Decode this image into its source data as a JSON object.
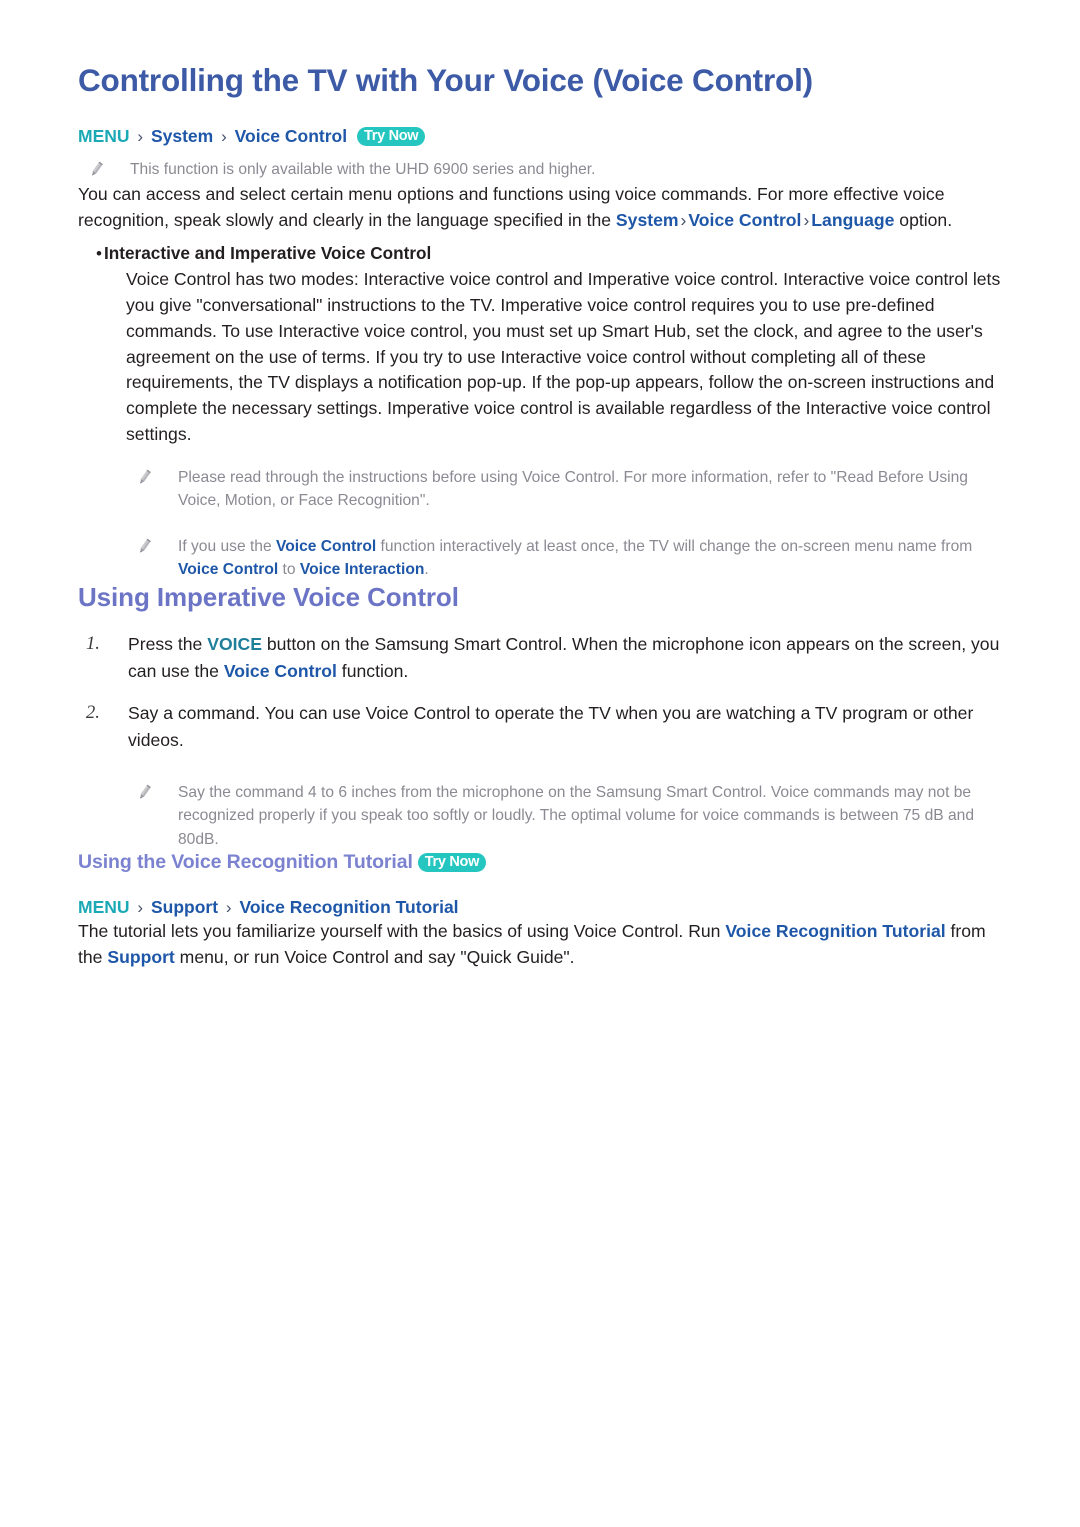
{
  "doc": {
    "title": "Controlling the TV with Your Voice (Voice Control)",
    "try_now_label": "Try Now",
    "arrow": "›",
    "bullet": "•"
  },
  "colors": {
    "title_blue": "#3c5aa6",
    "section_purple": "#6c74c6",
    "link_blue": "#1f57a8",
    "menu_teal": "#1aa9b5",
    "badge_teal": "#26c6c0",
    "note_gray": "#8a8a92",
    "body_black": "#231f20",
    "voice_teal": "#1f7f9b"
  },
  "breadcrumb_top": {
    "menu": "MENU",
    "items": [
      "System",
      "Voice Control"
    ]
  },
  "notes": {
    "availability": "This function is only available with the UHD 6900 series and higher.",
    "read_instructions": {
      "part1": "Please read through the instructions before using Voice Control. For more information, refer to \"Read Before Using Voice, Motion, or Face Recognition\"."
    },
    "interactive_rename": {
      "p1": "If you use the ",
      "link1": "Voice Control",
      "p2": " function interactively at least once, the TV will change the on-screen menu name from ",
      "link2": "Voice Control",
      "p3": " to ",
      "link3": "Voice Interaction",
      "p4": "."
    },
    "distance": "Say the command 4 to 6 inches from the microphone on the Samsung Smart Control. Voice commands may not be recognized properly if you speak too softly or loudly. The optimal volume for voice commands is between 75 dB and 80dB."
  },
  "intro": {
    "p1": "You can access and select certain menu options and functions using voice commands. For more effective voice recognition, speak slowly and clearly in the language specified in the ",
    "link_system": "System",
    "link_voice_control": "Voice Control",
    "link_language": "Language",
    "p_end": " option."
  },
  "bullet_section": {
    "label": "Interactive and Imperative Voice Control",
    "paragraph": "Voice Control has two modes: Interactive voice control and Imperative voice control. Interactive voice control lets you give \"conversational\" instructions to the TV. Imperative voice control requires you to use pre-defined commands. To use Interactive voice control, you must set up Smart Hub, set the clock, and agree to the user's agreement on the use of terms. If you try to use Interactive voice control without completing all of these requirements, the TV displays a notification pop-up. If the pop-up appears, follow the on-screen instructions and complete the necessary settings. Imperative voice control is available regardless of the Interactive voice control settings."
  },
  "imperative_section": {
    "heading": "Using Imperative Voice Control",
    "steps": [
      {
        "marker": "1.",
        "p1": "Press the ",
        "link1": "VOICE",
        "p2": " button on the Samsung Smart Control. When the microphone icon appears on the screen, you can use the ",
        "link2": "Voice Control",
        "p3": " function."
      },
      {
        "marker": "2.",
        "p1": "Say a command. You can use Voice Control to operate the TV when you are watching a TV program or other videos.",
        "link1": "",
        "p2": "",
        "link2": "",
        "p3": ""
      }
    ]
  },
  "tutorial_section": {
    "heading": "Using the Voice Recognition Tutorial",
    "breadcrumb": {
      "menu": "MENU",
      "items": [
        "Support",
        "Voice Recognition Tutorial"
      ]
    },
    "paragraph": {
      "p1": "The tutorial lets you familiarize yourself with the basics of using Voice Control. Run ",
      "link1": "Voice Recognition Tutorial",
      "p2": " from the ",
      "link2": "Support",
      "p3": " menu, or run Voice Control and say \"Quick Guide\"."
    }
  }
}
